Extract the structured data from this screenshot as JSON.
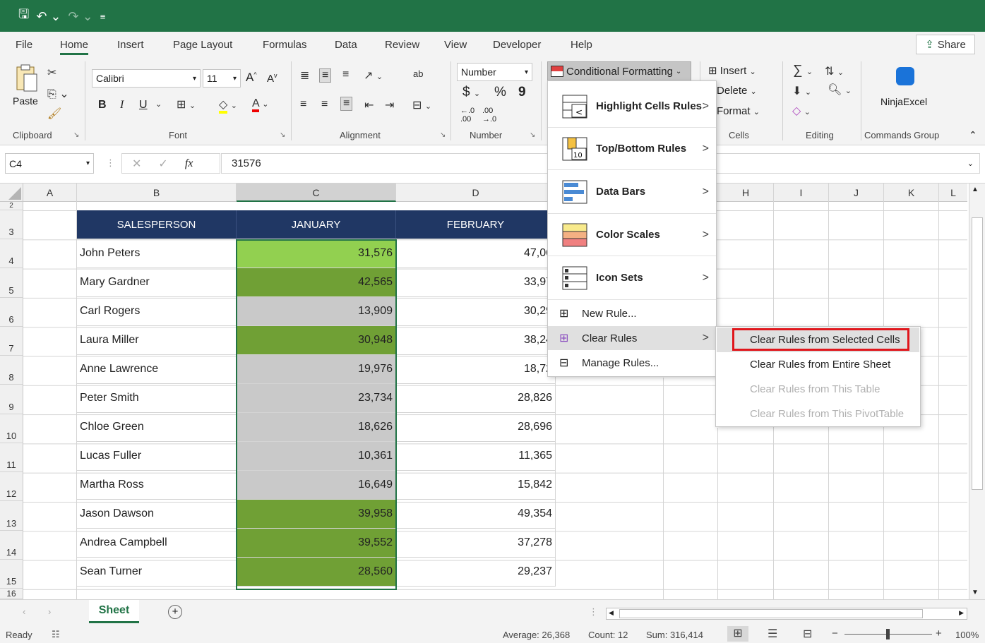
{
  "qat": {
    "save_icon": "save-icon",
    "undo_icon": "undo-icon",
    "redo_icon": "redo-icon"
  },
  "menu_tabs": [
    "File",
    "Home",
    "Insert",
    "Page Layout",
    "Formulas",
    "Data",
    "Review",
    "View",
    "Developer",
    "Help"
  ],
  "share_label": "Share",
  "ribbon": {
    "clipboard": {
      "paste": "Paste",
      "label": "Clipboard"
    },
    "font": {
      "name": "Calibri",
      "size": "11",
      "bold": "B",
      "italic": "I",
      "underline": "U",
      "label": "Font"
    },
    "alignment": {
      "label": "Alignment"
    },
    "number": {
      "format": "Number",
      "currency": "$",
      "percent": "%",
      "comma": "9",
      "label": "Number"
    },
    "styles": {
      "conditional": "Conditional Formatting"
    },
    "cells": {
      "insert": "Insert",
      "delete": "Delete",
      "format": "Format",
      "label": "Cells"
    },
    "editing": {
      "label": "Editing"
    },
    "commands": {
      "name": "NinjaExcel",
      "label": "Commands Group"
    }
  },
  "formula_bar": {
    "name_box": "C4",
    "fx": "fx",
    "value": "31576"
  },
  "columns": [
    "A",
    "B",
    "C",
    "D",
    "H",
    "I",
    "J",
    "K",
    "L"
  ],
  "rows": [
    "2",
    "3",
    "4",
    "5",
    "6",
    "7",
    "8",
    "9",
    "10",
    "11",
    "12",
    "13",
    "14",
    "15",
    "16"
  ],
  "table": {
    "headers": [
      "SALESPERSON",
      "JANUARY",
      "FEBRUARY"
    ],
    "rows": [
      {
        "name": "John Peters",
        "jan": "31,576",
        "feb": "47,06"
      },
      {
        "name": "Mary Gardner",
        "jan": "42,565",
        "feb": "33,97"
      },
      {
        "name": "Carl Rogers",
        "jan": "13,909",
        "feb": "30,29"
      },
      {
        "name": "Laura Miller",
        "jan": "30,948",
        "feb": "38,24"
      },
      {
        "name": "Anne Lawrence",
        "jan": "19,976",
        "feb": "18,72"
      },
      {
        "name": "Peter Smith",
        "jan": "23,734",
        "feb": "28,826"
      },
      {
        "name": "Chloe Green",
        "jan": "18,626",
        "feb": "28,696"
      },
      {
        "name": "Lucas Fuller",
        "jan": "10,361",
        "feb": "11,365"
      },
      {
        "name": "Martha Ross",
        "jan": "16,649",
        "feb": "15,842"
      },
      {
        "name": "Jason Dawson",
        "jan": "39,958",
        "feb": "49,354"
      },
      {
        "name": "Andrea Campbell",
        "jan": "39,552",
        "feb": "37,278"
      },
      {
        "name": "Sean Turner",
        "jan": "28,560",
        "feb": "29,237"
      }
    ],
    "jan_fill_colors": [
      "#92d050",
      "#70a035",
      "#c9c9c9",
      "#70a035",
      "#c9c9c9",
      "#c9c9c9",
      "#c9c9c9",
      "#c9c9c9",
      "#c9c9c9",
      "#70a035",
      "#70a035",
      "#70a035"
    ]
  },
  "cf_menu": {
    "items": [
      "Highlight Cells Rules",
      "Top/Bottom Rules",
      "Data Bars",
      "Color Scales",
      "Icon Sets",
      "New Rule...",
      "Clear Rules",
      "Manage Rules..."
    ]
  },
  "clear_submenu": {
    "items": [
      "Clear Rules from Selected Cells",
      "Clear Rules from Entire Sheet",
      "Clear Rules from This Table",
      "Clear Rules from This PivotTable"
    ]
  },
  "sheet_tab": "Sheet",
  "status": {
    "ready": "Ready",
    "average": "Average: 26,368",
    "count": "Count: 12",
    "sum": "Sum: 316,414",
    "zoom": "100%"
  },
  "colors": {
    "brand": "#217346",
    "header_fill": "#203764",
    "highlight_border": "#e0161c"
  }
}
